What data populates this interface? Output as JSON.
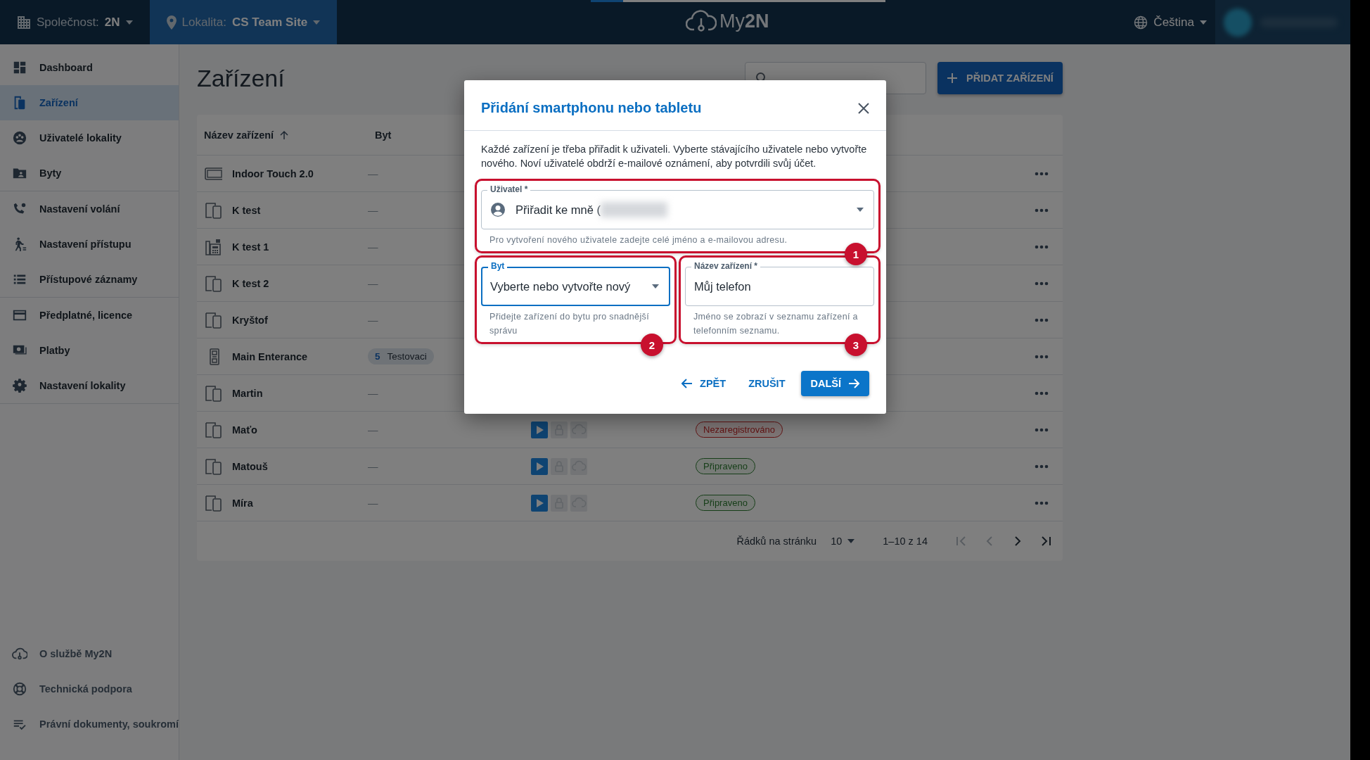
{
  "top_bar": {
    "company_label": "Společnost:",
    "company": "2N",
    "location_label": "Lokalita:",
    "location": "CS Team Site",
    "logo": "My**2N**",
    "language": "Čeština",
    "loading_bar": {
      "level": 0.11
    }
  },
  "sidebar": {
    "groups": [
      {
        "items": [
          {
            "label": "Dashboard",
            "selected": false
          },
          {
            "label": "Zařízení",
            "selected": true
          },
          {
            "label": "Uživatelé lokality",
            "selected": false
          },
          {
            "label": "Byty",
            "selected": false
          }
        ]
      },
      {
        "items": [
          {
            "label": "Nastavení volání",
            "selected": false
          },
          {
            "label": "Nastavení přístupu",
            "selected": false
          },
          {
            "label": "Přístupové záznamy",
            "selected": false
          }
        ]
      },
      {
        "items": [
          {
            "label": "Předplatné, licence",
            "selected": false
          },
          {
            "label": "Platby",
            "selected": false
          },
          {
            "label": "Nastavení lokality",
            "selected": false
          }
        ]
      }
    ],
    "footer_items": [
      {
        "label": "O službě My2N"
      },
      {
        "label": "Technická podpora"
      },
      {
        "label": "Právní dokumenty, soukromí"
      }
    ]
  },
  "page": {
    "title": "Zařízení",
    "add_button": "PŘIDAT ZAŘÍZENÍ"
  },
  "table": {
    "columns": [
      {
        "label": "Název zařízení",
        "sorted": true
      },
      {
        "label": "Byt",
        "sorted": false
      }
    ],
    "rows": [
      {
        "kind": "indoor-unit",
        "name": "Indoor Touch 2.0",
        "apartment": "—"
      },
      {
        "kind": "mobile",
        "name": "K test",
        "apartment": "—"
      },
      {
        "kind": "intercom",
        "name": "K test 1",
        "apartment": "—"
      },
      {
        "kind": "mobile",
        "name": "K test 2",
        "apartment": "—"
      },
      {
        "kind": "mobile",
        "name": "Kryštof",
        "apartment": "—"
      },
      {
        "kind": "access-unit",
        "name": "Main Enterance",
        "apartment_chip": {
          "number": "5",
          "name": "Testovaci"
        }
      },
      {
        "kind": "mobile",
        "name": "Martin",
        "apartment": "—"
      },
      {
        "kind": "mobile",
        "name": "Maťo",
        "apartment": "—",
        "services": [
          {
            "kind": "play",
            "enabled": true
          },
          {
            "kind": "lock",
            "enabled": false
          },
          {
            "kind": "cloud",
            "enabled": false
          }
        ],
        "status": {
          "label": "Nezaregistrováno",
          "kind": "error"
        }
      },
      {
        "kind": "mobile",
        "name": "Matouš",
        "apartment": "—",
        "services": [
          {
            "kind": "play",
            "enabled": true
          },
          {
            "kind": "lock",
            "enabled": false
          },
          {
            "kind": "cloud",
            "enabled": false
          }
        ],
        "status": {
          "label": "Připraveno",
          "kind": "ready"
        }
      },
      {
        "kind": "mobile",
        "name": "Míra",
        "apartment": "—",
        "services": [
          {
            "kind": "play",
            "enabled": true
          },
          {
            "kind": "lock",
            "enabled": false
          },
          {
            "kind": "cloud",
            "enabled": false
          }
        ],
        "status": {
          "label": "Připraveno",
          "kind": "ready"
        }
      }
    ],
    "pagination": {
      "rows_per_page_label": "Řádků na stránku",
      "rows_per_page": "10",
      "range": "1–10 z 14",
      "nav": [
        {
          "kind": "first",
          "disabled": true
        },
        {
          "kind": "prev",
          "disabled": true
        },
        {
          "kind": "next",
          "disabled": false
        },
        {
          "kind": "last",
          "disabled": false
        }
      ]
    }
  },
  "dialog": {
    "title": "Přidání smartphonu nebo tabletu",
    "description": "Každé zařízení je třeba přiřadit k uživateli. Vyberte stávajícího uživatele nebo vytvořte nového. Noví uživatelé obdrží e-mailové oznámení, aby potvrdili svůj účet.",
    "fields": [
      {
        "kind": "user-select",
        "label": "Uživatel *",
        "value": "Přiřadit ke mně (",
        "redacted": true,
        "focused": false,
        "helper": "Pro vytvoření nového uživatele zadejte celé jméno a e-mailovou adresu.",
        "annotation": "1"
      },
      {
        "kind": "select",
        "label": "Byt",
        "value": "Vyberte nebo vytvořte nový",
        "redacted": false,
        "focused": true,
        "helper": "Přidejte zařízení do bytu pro snadnější správu",
        "annotation": "2"
      },
      {
        "kind": "text",
        "label": "Název zařízení *",
        "value": "Můj telefon",
        "redacted": false,
        "focused": false,
        "helper": "Jméno se zobrazí v seznamu zařízení a telefonním seznamu.",
        "annotation": "3"
      }
    ],
    "buttons": [
      {
        "kind": "back",
        "label": "ZPĚT"
      },
      {
        "kind": "text",
        "label": "ZRUŠIT"
      },
      {
        "kind": "primary",
        "label": "DALŠÍ"
      }
    ]
  }
}
